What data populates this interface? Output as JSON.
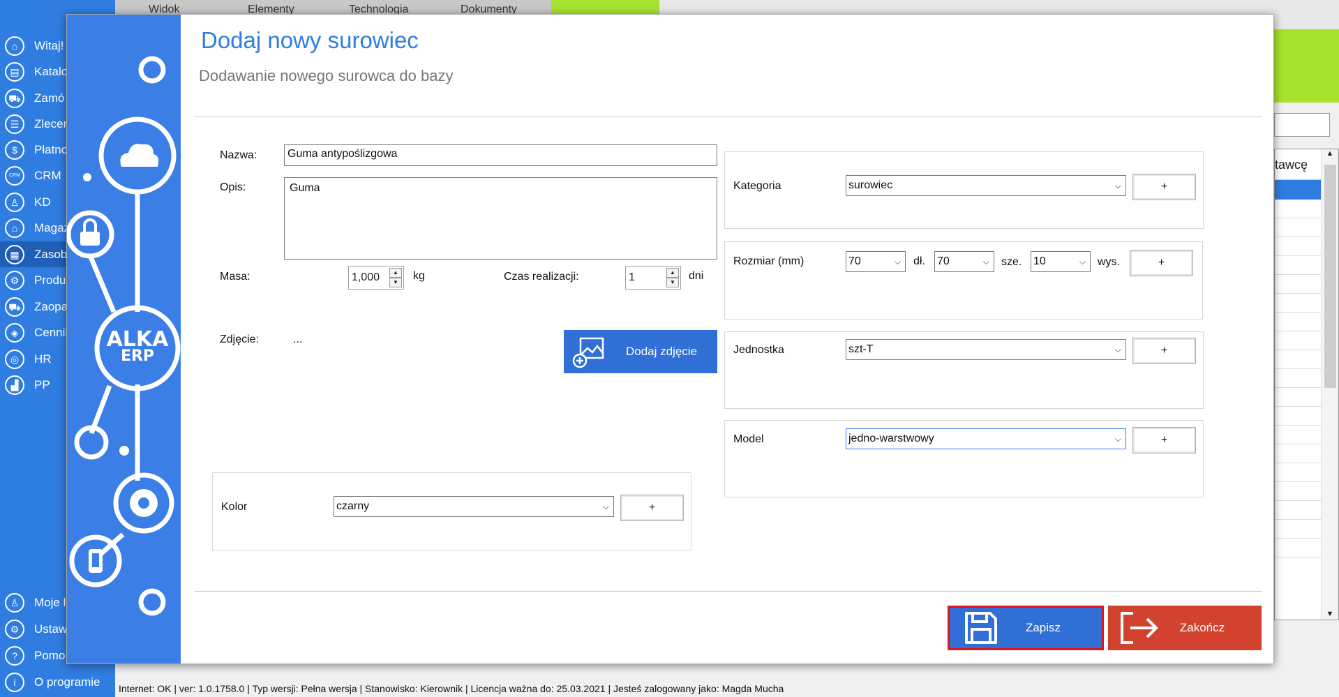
{
  "app": {
    "sidebar": {
      "items": [
        {
          "label": "Witaj!",
          "icon": "home-icon",
          "glyph": "⌂"
        },
        {
          "label": "Katalo",
          "icon": "book-icon",
          "glyph": "▤"
        },
        {
          "label": "Zamó",
          "icon": "cart-icon",
          "glyph": "⛟"
        },
        {
          "label": "Zlecer",
          "icon": "list-icon",
          "glyph": "☰"
        },
        {
          "label": "Płatno",
          "icon": "dollar-icon",
          "glyph": "$"
        },
        {
          "label": "CRM",
          "icon": "crm-icon",
          "glyph": "CRM"
        },
        {
          "label": "KD",
          "icon": "person-icon",
          "glyph": "♙"
        },
        {
          "label": "Magaz",
          "icon": "warehouse-icon",
          "glyph": "⌂"
        },
        {
          "label": "Zasob",
          "icon": "resources-icon",
          "glyph": "▦"
        },
        {
          "label": "Produ",
          "icon": "production-icon",
          "glyph": "⚙"
        },
        {
          "label": "Zaopa",
          "icon": "truck-icon",
          "glyph": "⛟"
        },
        {
          "label": "Cennik",
          "icon": "tag-icon",
          "glyph": "◈"
        },
        {
          "label": "HR",
          "icon": "hr-icon",
          "glyph": "◎"
        },
        {
          "label": "PP",
          "icon": "factory-icon",
          "glyph": "▟"
        }
      ],
      "bottom_items": [
        {
          "label": "Moje l",
          "icon": "user-icon",
          "glyph": "♙"
        },
        {
          "label": "Ustawi",
          "icon": "settings-icon",
          "glyph": "⚙"
        },
        {
          "label": "Pomo",
          "icon": "help-icon",
          "glyph": "?"
        },
        {
          "label": "O programie",
          "icon": "info-icon",
          "glyph": "i"
        }
      ]
    },
    "top_tabs": [
      "Widok",
      "Elementy",
      "Technologia",
      "Dokumenty"
    ],
    "right_table_header": "tawcę",
    "status_bar": "Internet: OK  |  ver: 1.0.1758.0  |  Typ wersji: Pełna wersja  |  Stanowisko: Kierownik  |  Licencja ważna do: 25.03.2021  |  Jesteś zalogowany jako: Magda Mucha"
  },
  "dialog": {
    "title": "Dodaj nowy surowiec",
    "subtitle": "Dodawanie nowego surowca do bazy",
    "logo_line1": "ALKA",
    "logo_line2": "ERP",
    "nazwa_label": "Nazwa:",
    "nazwa_value": "Guma antypoślizgowa",
    "opis_label": "Opis:",
    "opis_value": "Guma",
    "masa_label": "Masa:",
    "masa_value": "1,000",
    "masa_unit": "kg",
    "czas_label": "Czas realizacji:",
    "czas_value": "1",
    "czas_unit": "dni",
    "zdjecie_label": "Zdjęcie:",
    "zdjecie_value": "...",
    "add_photo_label": "Dodaj zdjęcie",
    "kolor_label": "Kolor",
    "kolor_value": "czarny",
    "kategoria_label": "Kategoria",
    "kategoria_value": "surowiec",
    "rozmiar_label": "Rozmiar (mm)",
    "dl_value": "70",
    "dl_label": "dł.",
    "sze_value": "70",
    "sze_label": "sze.",
    "wys_value": "10",
    "wys_label": "wys.",
    "jednostka_label": "Jednostka",
    "jednostka_value": "szt-T",
    "model_label": "Model",
    "model_value": "jedno-warstwowy",
    "plus_label": "+",
    "save_label": "Zapisz",
    "close_label": "Zakończ"
  },
  "colors": {
    "sidebar_blue": "#2f7de1",
    "dialog_left_blue": "#3a7ee6",
    "accent_green": "#a6e22e",
    "save_blue": "#2f6fd6",
    "save_border_red": "#d9161f",
    "close_red": "#d1432f"
  }
}
